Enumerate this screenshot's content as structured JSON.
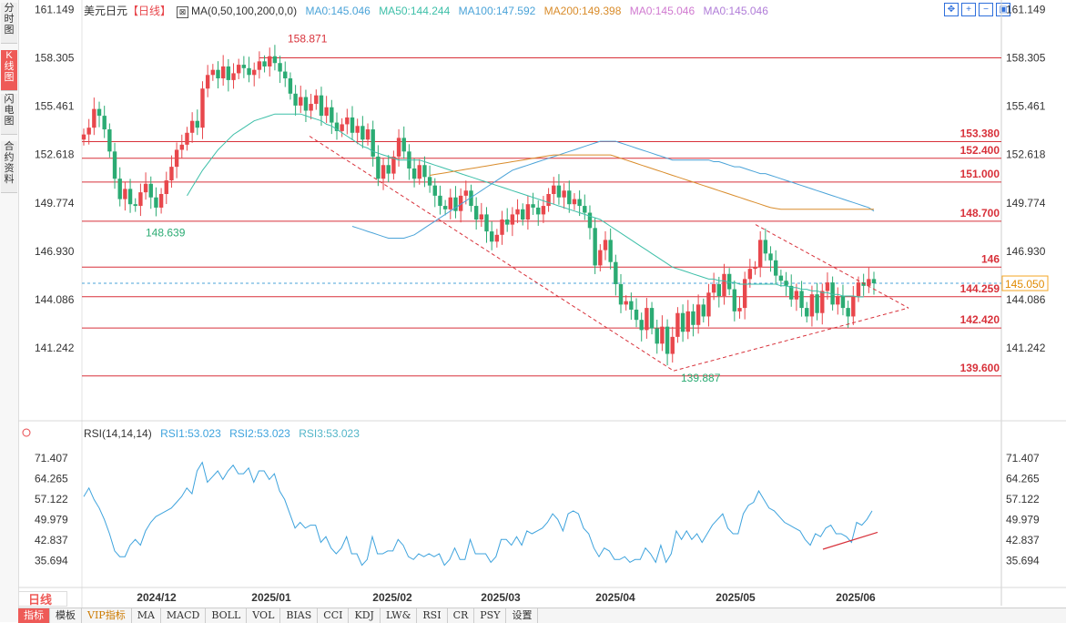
{
  "side_tabs": [
    "分时图",
    "K线图",
    "闪电图",
    "合约资料"
  ],
  "legend": {
    "title": "美元日元",
    "period": "【日线】",
    "ma_params": "MA(0,50,100,200,0,0)",
    "ma1": "MA0:145.046",
    "ma50": "MA50:144.244",
    "ma100": "MA100:147.592",
    "ma200": "MA200:149.398",
    "ma0b": "MA0:145.046",
    "ma0c": "MA0:145.046"
  },
  "colors": {
    "up": "#e8474c",
    "down": "#2bab73",
    "ma50": "#3dbfa8",
    "ma100": "#4aa3d8",
    "ma200": "#d98c2b",
    "support": "#d8313a",
    "rsi": "#3ea3dd",
    "legend_ma0": "#d079d0"
  },
  "toolbar_icons": [
    "move-icon",
    "zoom-in-icon",
    "zoom-out-icon",
    "reset-icon"
  ],
  "rsi_legend": {
    "params": "RSI(14,14,14)",
    "rsi1": "RSI1:53.023",
    "rsi2": "RSI2:53.023",
    "rsi3": "RSI3:53.023"
  },
  "period_button": "日线 ▲",
  "bottom_tabs": [
    "指标",
    "模板",
    "VIP指标",
    "MA",
    "MACD",
    "BOLL",
    "VOL",
    "BIAS",
    "CCI",
    "KDJ",
    "LW&",
    "RSI",
    "CR",
    "PSY",
    "设置"
  ],
  "current_price": "145.050",
  "chart_data": [
    {
      "type": "candlestick",
      "ylim": [
        139.0,
        161.6
      ],
      "y_ticks": [
        "161.149",
        "158.305",
        "155.461",
        "152.618",
        "149.774",
        "146.930",
        "144.086",
        "141.242"
      ],
      "x_ticks": [
        "2024/12",
        "2025/01",
        "2025/02",
        "2025/03",
        "2025/04",
        "2025/05",
        "2025/06"
      ],
      "close": [
        153.8,
        154.2,
        155.3,
        154.9,
        154.1,
        152.8,
        151.2,
        150.0,
        150.6,
        149.7,
        149.6,
        150.4,
        150.9,
        150.1,
        149.5,
        150.3,
        151.1,
        151.9,
        152.9,
        153.2,
        153.9,
        154.6,
        154.2,
        156.5,
        157.3,
        157.6,
        157.1,
        157.8,
        157.0,
        157.4,
        157.9,
        157.7,
        157.3,
        157.6,
        158.1,
        157.8,
        158.4,
        158.0,
        157.5,
        157.1,
        156.2,
        155.5,
        156.0,
        155.2,
        155.6,
        156.1,
        154.9,
        155.4,
        154.5,
        154.0,
        154.4,
        154.8,
        153.9,
        154.3,
        153.5,
        154.1,
        152.5,
        151.2,
        152.0,
        151.5,
        152.5,
        153.6,
        152.8,
        151.8,
        151.2,
        152.0,
        151.3,
        150.8,
        150.2,
        149.6,
        149.4,
        150.1,
        149.3,
        150.2,
        150.5,
        149.6,
        148.8,
        149.1,
        148.1,
        147.5,
        147.9,
        148.8,
        148.5,
        149.1,
        149.4,
        148.8,
        149.7,
        149.5,
        149.1,
        149.6,
        150.3,
        150.8,
        150.1,
        150.5,
        149.7,
        150.0,
        149.6,
        149.2,
        148.3,
        146.1,
        147.0,
        147.6,
        146.3,
        145.0,
        143.8,
        144.0,
        143.5,
        142.9,
        142.3,
        143.6,
        142.4,
        141.5,
        142.5,
        140.9,
        141.9,
        143.3,
        142.2,
        143.4,
        142.6,
        143.8,
        143.1,
        144.5,
        145.0,
        144.3,
        145.6,
        144.7,
        143.4,
        143.6,
        145.3,
        145.9,
        146.0,
        147.6,
        146.8,
        146.4,
        145.5,
        145.2,
        144.9,
        144.1,
        144.6,
        143.6,
        143.1,
        144.4,
        143.3,
        144.6,
        145.1,
        143.8,
        144.3,
        143.6,
        143.1,
        144.3,
        145.1,
        144.9,
        145.3,
        145.05
      ],
      "series": [
        {
          "name": "MA50",
          "values": [
            null,
            null,
            null,
            null,
            null,
            null,
            null,
            null,
            null,
            null,
            null,
            null,
            null,
            null,
            null,
            null,
            null,
            null,
            null,
            null,
            150.2,
            150.7,
            151.2,
            151.7,
            152.1,
            152.5,
            152.9,
            153.2,
            153.5,
            153.8,
            154.0,
            154.2,
            154.4,
            154.6,
            154.7,
            154.8,
            154.9,
            155.0,
            155.0,
            155.0,
            155.0,
            155.0,
            155.0,
            154.9,
            154.8,
            154.7,
            154.6,
            154.4,
            154.3,
            154.1,
            153.9,
            153.7,
            153.5,
            153.3,
            153.1,
            153.0,
            152.8,
            152.7,
            152.6,
            152.5,
            152.4,
            152.3,
            152.3,
            152.3,
            152.3,
            152.3,
            152.2,
            152.1,
            152.0,
            151.9,
            151.8,
            151.7,
            151.6,
            151.5,
            151.4,
            151.3,
            151.2,
            151.1,
            151.0,
            150.9,
            150.8,
            150.7,
            150.6,
            150.5,
            150.4,
            150.3,
            150.2,
            150.1,
            150.0,
            149.9,
            149.8,
            149.7,
            149.6,
            149.5,
            149.4,
            149.3,
            149.2,
            149.1,
            149.0,
            148.9,
            148.8,
            148.6,
            148.4,
            148.2,
            148.0,
            147.8,
            147.6,
            147.4,
            147.2,
            147.0,
            146.8,
            146.6,
            146.4,
            146.2,
            146.0,
            145.9,
            145.8,
            145.7,
            145.6,
            145.5,
            145.4,
            145.3,
            145.3,
            145.2,
            145.2,
            145.1,
            145.1,
            145.0,
            145.0,
            145.0,
            145.0,
            145.0,
            145.0,
            145.0,
            145.0,
            144.9,
            144.9,
            144.8,
            144.8,
            144.7,
            144.7,
            144.6,
            144.6,
            144.5,
            144.5,
            144.4,
            144.4,
            144.3,
            144.3,
            144.3,
            144.25,
            144.25
          ]
        },
        {
          "name": "MA100",
          "values": [
            148.4,
            148.3,
            148.2,
            148.1,
            148.0,
            147.9,
            147.8,
            147.7,
            147.7,
            147.7,
            147.7,
            147.8,
            147.9,
            148.1,
            148.3,
            148.5,
            148.7,
            148.9,
            149.1,
            149.3,
            149.5,
            149.7,
            149.9,
            150.1,
            150.3,
            150.5,
            150.7,
            150.9,
            151.1,
            151.3,
            151.5,
            151.7,
            151.8,
            151.9,
            152.0,
            152.1,
            152.2,
            152.3,
            152.4,
            152.5,
            152.6,
            152.7,
            152.8,
            152.9,
            153.0,
            153.1,
            153.2,
            153.3,
            153.4,
            153.4,
            153.4,
            153.4,
            153.3,
            153.2,
            153.1,
            153.0,
            152.9,
            152.8,
            152.7,
            152.6,
            152.5,
            152.4,
            152.3,
            152.3,
            152.3,
            152.3,
            152.3,
            152.3,
            152.3,
            152.3,
            152.2,
            152.2,
            152.1,
            152.0,
            151.9,
            151.9,
            151.8,
            151.7,
            151.6,
            151.5,
            151.5,
            151.4,
            151.3,
            151.2,
            151.1,
            151.0,
            150.9,
            150.8,
            150.7,
            150.6,
            150.5,
            150.4,
            150.3,
            150.2,
            150.1,
            150.0,
            149.9,
            149.8,
            149.7,
            149.6,
            149.5,
            149.3,
            149.1,
            148.9,
            148.7,
            148.5,
            148.3,
            148.1,
            147.9,
            147.7,
            147.5
          ]
        },
        {
          "name": "MA200",
          "values": [
            151.4,
            151.45,
            151.5,
            151.55,
            151.6,
            151.65,
            151.7,
            151.75,
            151.8,
            151.85,
            151.9,
            151.95,
            152.0,
            152.05,
            152.1,
            152.15,
            152.2,
            152.25,
            152.3,
            152.35,
            152.4,
            152.45,
            152.5,
            152.55,
            152.6,
            152.6,
            152.6,
            152.6,
            152.6,
            152.6,
            152.6,
            152.6,
            152.6,
            152.6,
            152.6,
            152.6,
            152.5,
            152.4,
            152.3,
            152.2,
            152.1,
            152.0,
            151.9,
            151.8,
            151.7,
            151.6,
            151.5,
            151.4,
            151.3,
            151.2,
            151.1,
            151.0,
            150.9,
            150.8,
            150.7,
            150.6,
            150.5,
            150.4,
            150.3,
            150.2,
            150.1,
            150.0,
            149.9,
            149.8,
            149.7,
            149.6,
            149.5,
            149.45,
            149.4,
            149.4,
            149.4,
            149.4,
            149.4,
            149.4,
            149.4,
            149.4,
            149.4,
            149.4,
            149.4,
            149.4,
            149.4,
            149.4,
            149.4,
            149.4,
            149.4,
            149.4,
            149.4,
            149.4,
            149.4,
            149.4,
            149.4,
            149.4,
            149.4,
            149.4
          ]
        }
      ],
      "series_start_index": [
        0,
        52,
        67
      ],
      "horizontal_levels": [
        {
          "value": 158.305,
          "label": ""
        },
        {
          "value": 153.38,
          "label": "153.380"
        },
        {
          "value": 152.4,
          "label": "152.400"
        },
        {
          "value": 151.0,
          "label": "151.000"
        },
        {
          "value": 148.7,
          "label": "148.700"
        },
        {
          "value": 146.0,
          "label": "146"
        },
        {
          "value": 144.259,
          "label": "144.259"
        },
        {
          "value": 142.42,
          "label": "142.420"
        },
        {
          "value": 139.6,
          "label": "139.600"
        }
      ],
      "annotations": [
        "158.871",
        "148.639",
        "139.887"
      ]
    },
    {
      "type": "line",
      "title": "RSI(14,14,14)",
      "ylim": [
        31,
        74
      ],
      "y_ticks": [
        "71.407",
        "64.265",
        "57.122",
        "49.979",
        "42.837",
        "35.694"
      ],
      "series": [
        {
          "name": "RSI1",
          "values": [
            58,
            61,
            57,
            54,
            50,
            45,
            39,
            37,
            37,
            41,
            43,
            41,
            46,
            49,
            51,
            52,
            53,
            54,
            56,
            58,
            61,
            59,
            67,
            70,
            63,
            65,
            67,
            64,
            67,
            69,
            66,
            66,
            68,
            63,
            67,
            67,
            64,
            66,
            60,
            57,
            52,
            47,
            49,
            47,
            48,
            48,
            42,
            44,
            40,
            38,
            40,
            44,
            38,
            38,
            34,
            36,
            44,
            38,
            38,
            39,
            39,
            43,
            41,
            37,
            36,
            38,
            37,
            38,
            37,
            38,
            34,
            36,
            40,
            36,
            36,
            43,
            38,
            38,
            38,
            35,
            37,
            43,
            43,
            41,
            44,
            41,
            46,
            45,
            46,
            47,
            49,
            52,
            50,
            46,
            52,
            53,
            52,
            47,
            45,
            40,
            37,
            40,
            39,
            36,
            36,
            37,
            35,
            36,
            36,
            40,
            38,
            35,
            41,
            35,
            38,
            46,
            43,
            46,
            43,
            45,
            42,
            45,
            48,
            50,
            52,
            47,
            45,
            45,
            52,
            55,
            56,
            60,
            57,
            54,
            53,
            51,
            49,
            48,
            47,
            46,
            43,
            41,
            45,
            44,
            47,
            48,
            45,
            45,
            44,
            42,
            49,
            48,
            50,
            53
          ]
        }
      ]
    }
  ]
}
